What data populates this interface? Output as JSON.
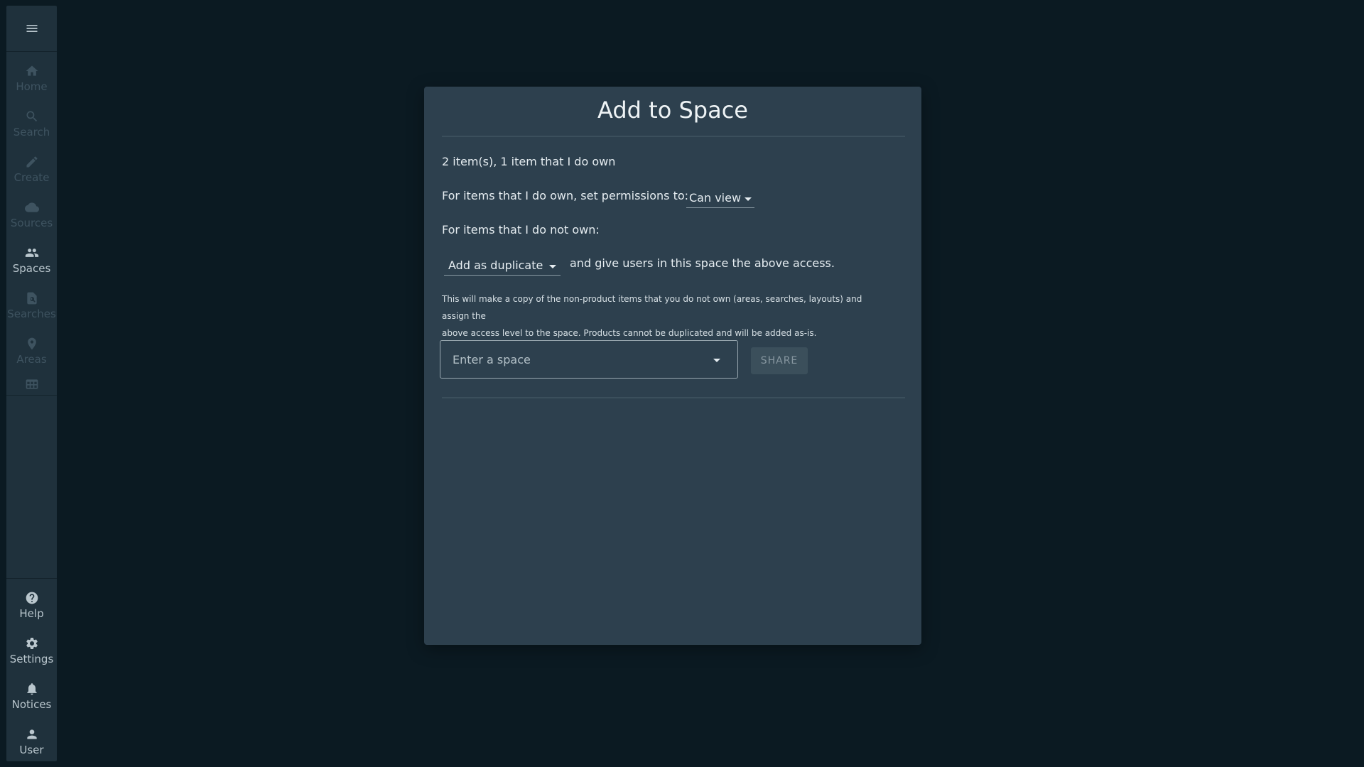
{
  "sidebar": {
    "menu_icon": "menu-icon",
    "items": [
      {
        "label": "Home",
        "icon": "home-icon"
      },
      {
        "label": "Search",
        "icon": "search-icon"
      },
      {
        "label": "Create",
        "icon": "pencil-icon"
      },
      {
        "label": "Sources",
        "icon": "cloud-icon"
      },
      {
        "label": "Spaces",
        "icon": "people-icon"
      },
      {
        "label": "Searches",
        "icon": "saved-search-icon"
      },
      {
        "label": "Areas",
        "icon": "location-pin-icon"
      },
      {
        "label": "",
        "icon": "layout-icon"
      }
    ],
    "bottom_items": [
      {
        "label": "Help",
        "icon": "help-icon"
      },
      {
        "label": "Settings",
        "icon": "gear-icon"
      },
      {
        "label": "Notices",
        "icon": "bell-icon"
      },
      {
        "label": "User",
        "icon": "user-icon"
      }
    ]
  },
  "dialog": {
    "title": "Add to Space",
    "summary": "2 item(s), 1 item that I do own",
    "owned_label": "For items that I do own, set permissions to:",
    "permission_value": "Can view",
    "not_owned_label": "For items that I do not own:",
    "duplicate_value": "Add as duplicate",
    "duplicate_suffix": "and give users in this space the above access.",
    "note_line1": "This will make a copy of the non-product items that you do not own (areas, searches, layouts) and assign the",
    "note_line2": "above access level to the space. Products cannot be duplicated and will be added as-is.",
    "space_placeholder": "Enter a space",
    "share_label": "SHARE"
  },
  "colors": {
    "background": "#0b1a22",
    "sidebar": "#1f313c",
    "dialog": "#2d404e"
  }
}
